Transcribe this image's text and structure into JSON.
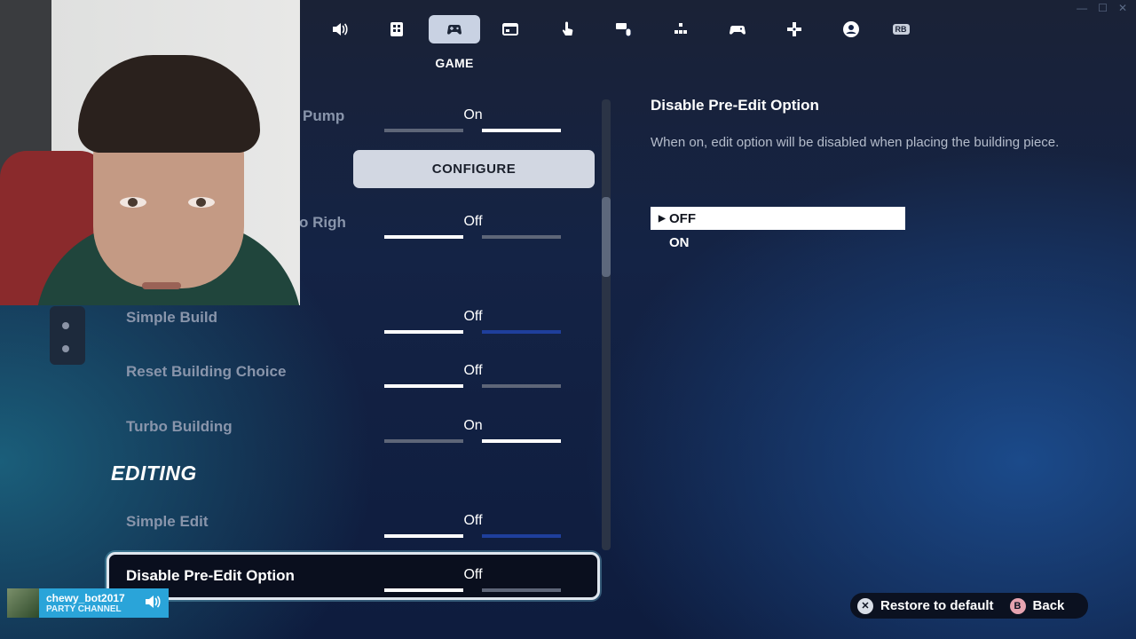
{
  "nav": {
    "tabs": [
      {
        "icon": "speaker-icon"
      },
      {
        "icon": "display-grid-icon"
      },
      {
        "icon": "game-controller-settings-icon"
      },
      {
        "icon": "window-icon"
      },
      {
        "icon": "touch-icon"
      },
      {
        "icon": "keyboard-mouse-icon"
      },
      {
        "icon": "button-layout-icon"
      },
      {
        "icon": "controller-icon"
      },
      {
        "icon": "dpad-icon"
      },
      {
        "icon": "account-icon"
      },
      {
        "icon": "rb-bumper-icon"
      }
    ],
    "active_index": 2,
    "active_label": "GAME",
    "rb_label": "RB"
  },
  "window_controls": {
    "minimize": "—",
    "maximize": "☐",
    "close": "✕"
  },
  "settings": {
    "pump_label": "Pump",
    "pump_value": "On",
    "configure_label": "CONFIGURE",
    "right_label": "o Righ",
    "right_value": "Off",
    "simple_build_label": "Simple Build",
    "simple_build_value": "Off",
    "reset_label": "Reset Building Choice",
    "reset_value": "Off",
    "turbo_label": "Turbo Building",
    "turbo_value": "On",
    "section_editing": "EDITING",
    "simple_edit_label": "Simple Edit",
    "simple_edit_value": "Off",
    "preedit_label": "Disable Pre-Edit Option",
    "preedit_value": "Off"
  },
  "description": {
    "title": "Disable Pre-Edit Option",
    "text": "When on, edit option will be disabled when placing the building piece.",
    "options": [
      "OFF",
      "ON"
    ],
    "selected": "OFF"
  },
  "footer": {
    "restore_glyph": "✕",
    "restore_label": "Restore to default",
    "back_glyph": "B",
    "back_label": "Back"
  },
  "party": {
    "username": "chewy_bot2017",
    "channel": "PARTY CHANNEL"
  }
}
